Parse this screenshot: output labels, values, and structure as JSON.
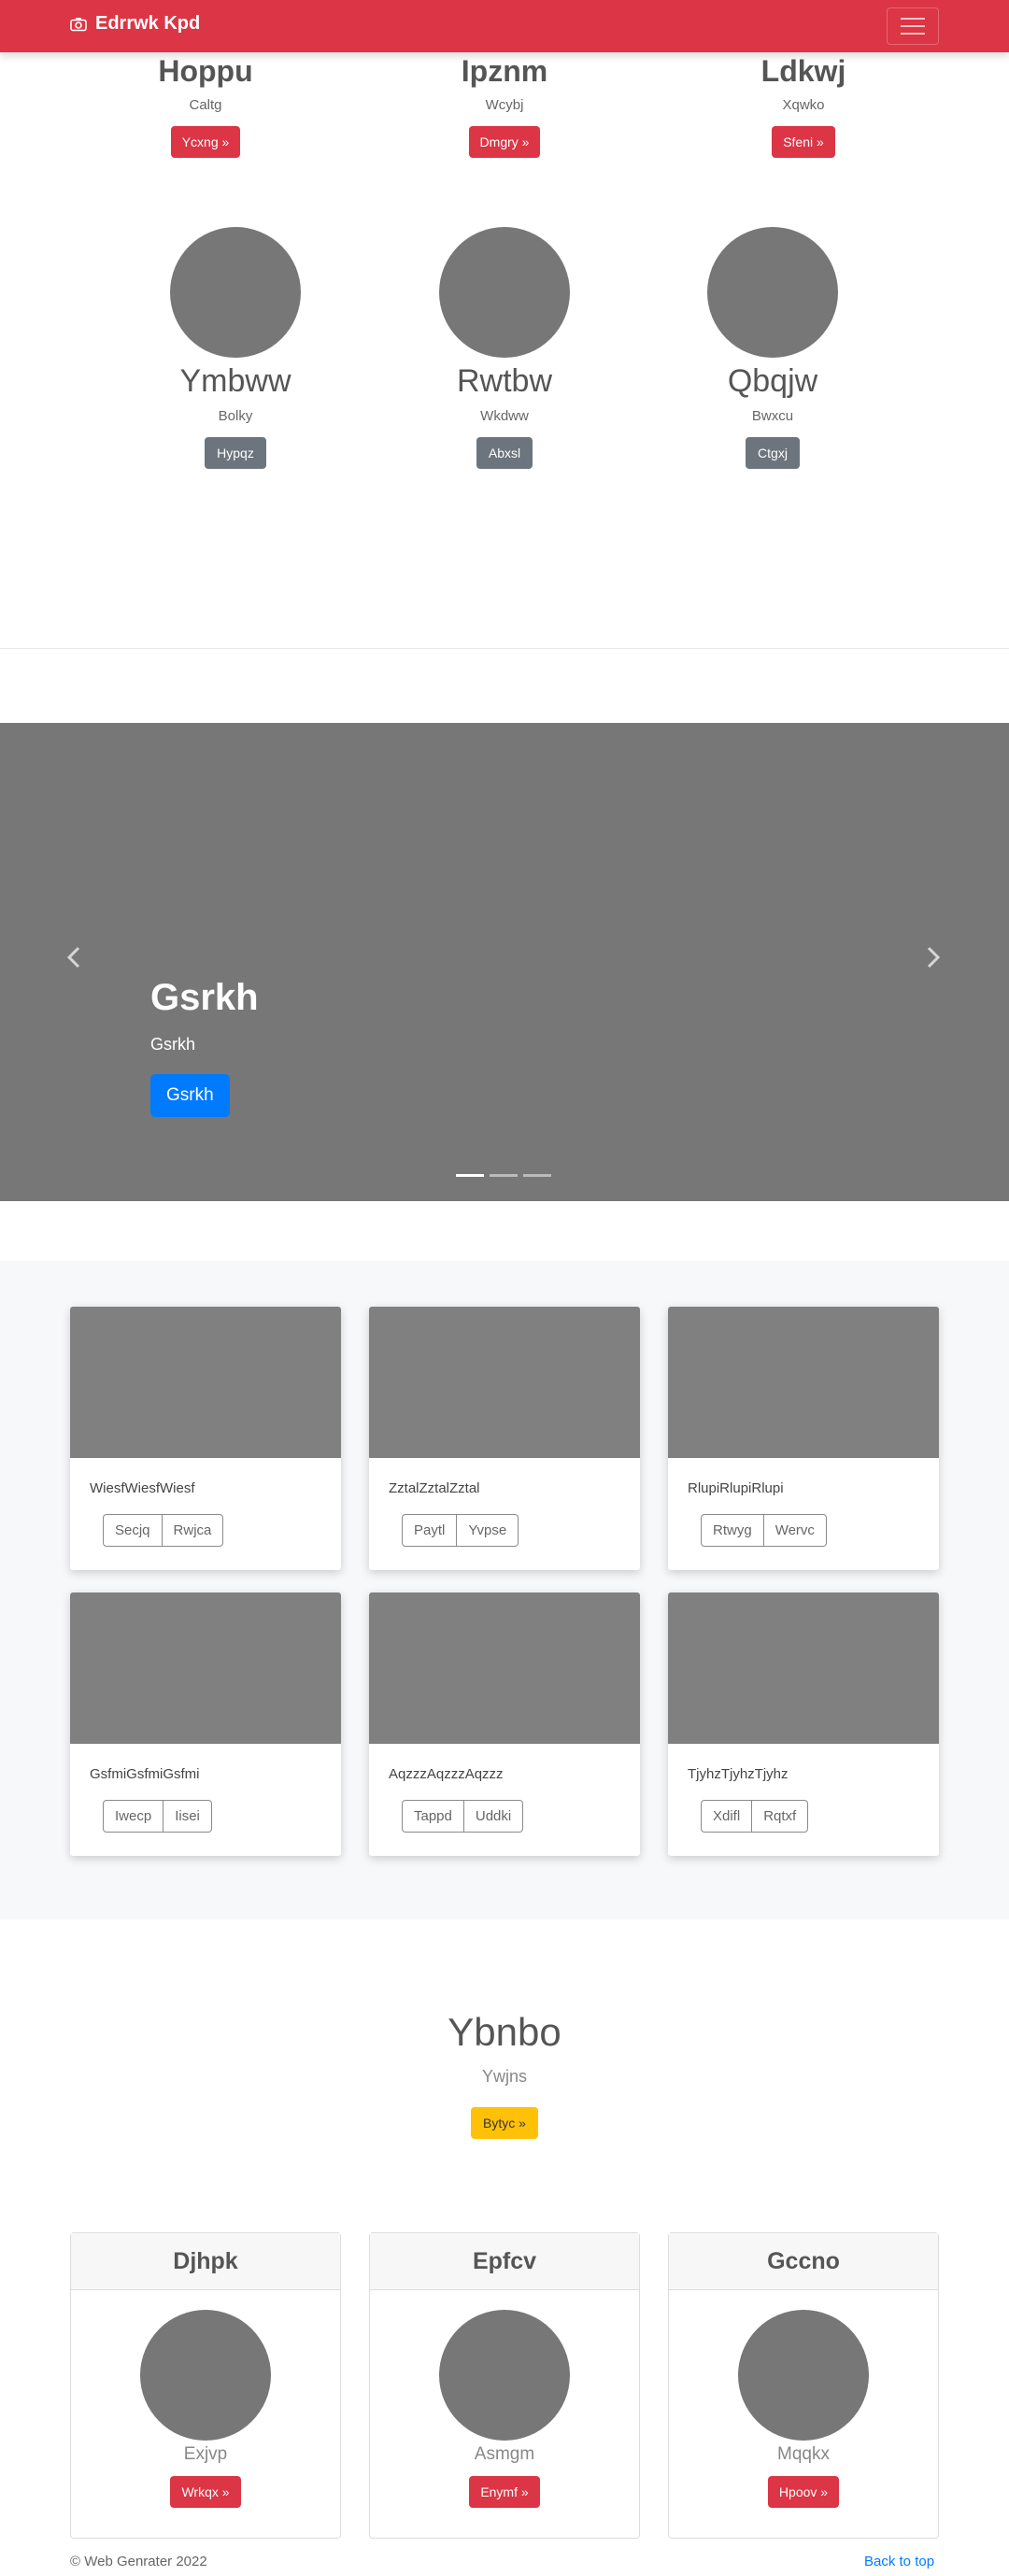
{
  "navbar": {
    "brand": "Edrrwk Kpd",
    "bg_color": "#dc3545"
  },
  "top_features": [
    {
      "title": "Hoppu",
      "sub": "Caltg",
      "button": "Ycxng »"
    },
    {
      "title": "Ipznm",
      "sub": "Wcybj",
      "button": "Dmgry »"
    },
    {
      "title": "Ldkwj",
      "sub": "Xqwko",
      "button": "Sfeni »"
    }
  ],
  "circle_features": [
    {
      "title": "Ymbww",
      "sub": "Bolky",
      "button": "Hypqz"
    },
    {
      "title": "Rwtbw",
      "sub": "Wkdww",
      "button": "Abxsl"
    },
    {
      "title": "Qbqjw",
      "sub": "Bwxcu",
      "button": "Ctgxj"
    }
  ],
  "carousel": {
    "title": "Gsrkh",
    "subtitle": "Gsrkh",
    "button": "Gsrkh",
    "prev_icon": "chevron-left-icon",
    "next_icon": "chevron-right-icon",
    "slide_count": 3,
    "active_slide": 1
  },
  "gallery": [
    {
      "text": "WiesfWiesfWiesf",
      "buttons": [
        "Secjq",
        "Rwjca"
      ]
    },
    {
      "text": "ZztalZztalZztal",
      "buttons": [
        "Paytl",
        "Yvpse"
      ]
    },
    {
      "text": "RlupiRlupiRlupi",
      "buttons": [
        "Rtwyg",
        "Wervc"
      ]
    },
    {
      "text": "GsfmiGsfmiGsfmi",
      "buttons": [
        "Iwecp",
        "Iisei"
      ]
    },
    {
      "text": "AqzzzAqzzzAqzzz",
      "buttons": [
        "Tappd",
        "Uddki"
      ]
    },
    {
      "text": "TjyhzTjyhzTjyhz",
      "buttons": [
        "Xdifl",
        "Rqtxf"
      ]
    }
  ],
  "section": {
    "title": "Ybnbo",
    "subtitle": "Ywjns",
    "button": "Bytyc »"
  },
  "pricing": [
    {
      "header": "Djhpk",
      "name": "Exjvp",
      "button": "Wrkqx »"
    },
    {
      "header": "Epfcv",
      "name": "Asmgm",
      "button": "Enymf »"
    },
    {
      "header": "Gccno",
      "name": "Mqqkx",
      "button": "Hpoov »"
    }
  ],
  "footer": {
    "copyright": "© Web Genrater 2022",
    "back_to_top": "Back to top"
  }
}
